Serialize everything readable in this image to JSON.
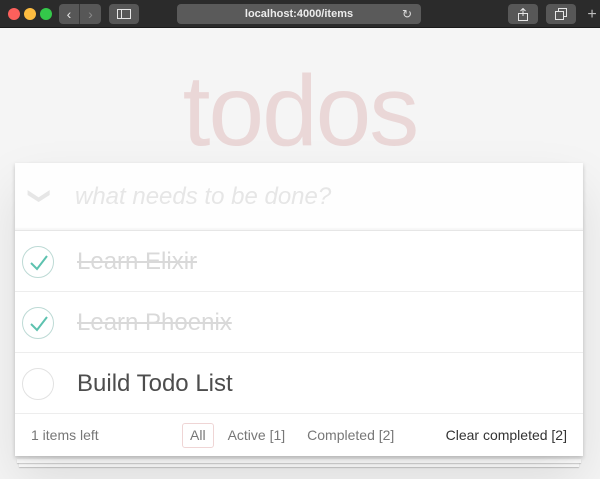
{
  "browser": {
    "url": "localhost:4000/items",
    "back_glyph": "‹",
    "forward_glyph": "›",
    "reload_glyph": "↻",
    "newtab_glyph": "+"
  },
  "app": {
    "title": "todos",
    "toggle_all_glyph": "❯",
    "new_todo_placeholder": "what needs to be done?",
    "new_todo_value": ""
  },
  "todos": [
    {
      "label": "Learn Elixir",
      "completed": true
    },
    {
      "label": "Learn Phoenix",
      "completed": true
    },
    {
      "label": "Build Todo List",
      "completed": false
    }
  ],
  "footer": {
    "count_text": "1 items left",
    "filters": [
      {
        "label": "All",
        "selected": true
      },
      {
        "label": "Active [1]",
        "selected": false
      },
      {
        "label": "Completed [2]",
        "selected": false
      }
    ],
    "clear_label": "Clear completed [2]"
  },
  "colors": {
    "title": "#af2f2f",
    "check_green": "#5dc2af",
    "chrome": "#2b2b2b"
  }
}
